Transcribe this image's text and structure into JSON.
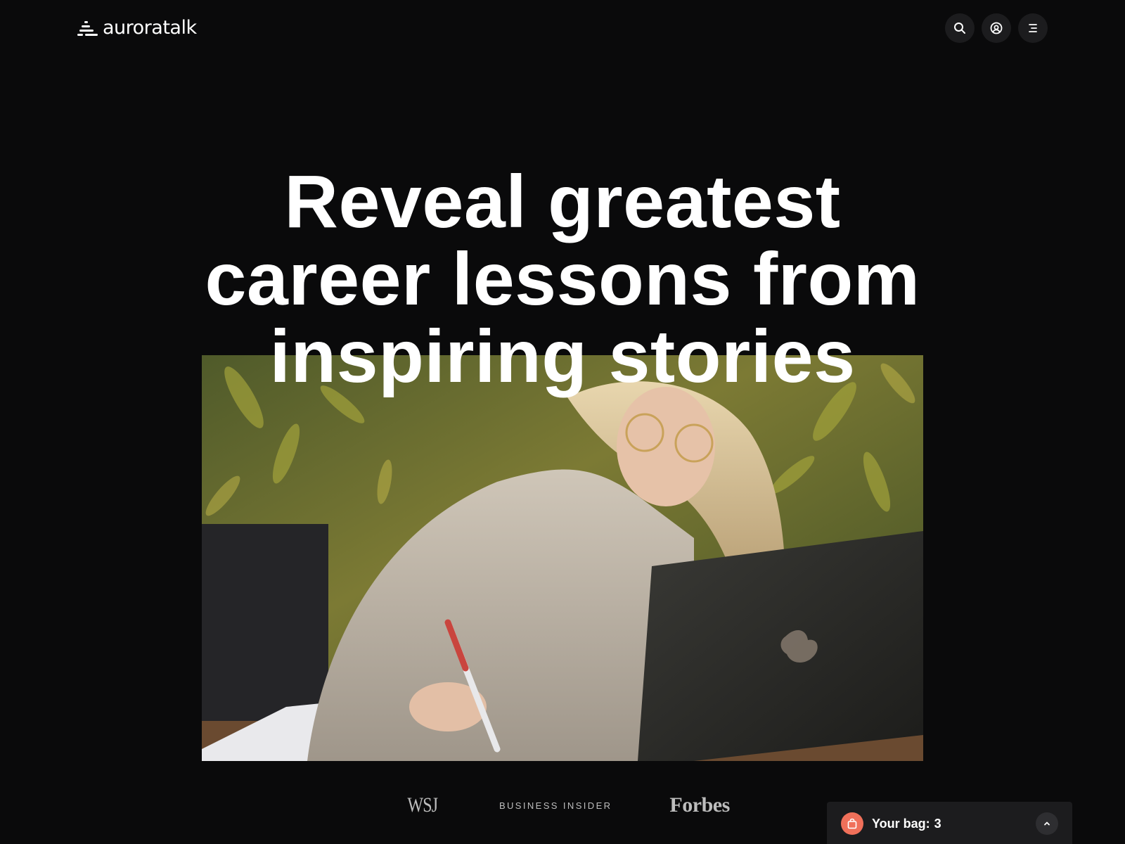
{
  "header": {
    "logo_text": "auroratalk",
    "icons": [
      "search-icon",
      "account-icon",
      "menu-icon"
    ]
  },
  "hero": {
    "title_lines": [
      "Reveal greatest",
      "career lessons from",
      "inspiring stories"
    ],
    "image": "woman-writing-notes-with-laptop"
  },
  "press": {
    "logos": [
      "WSJ",
      "BUSINESS INSIDER",
      "Forbes"
    ]
  },
  "bag": {
    "label": "Your bag:",
    "count": "3",
    "accent_color": "#f0705a"
  },
  "colors": {
    "background": "#0a0a0b",
    "button_bg": "#1c1c1e"
  }
}
